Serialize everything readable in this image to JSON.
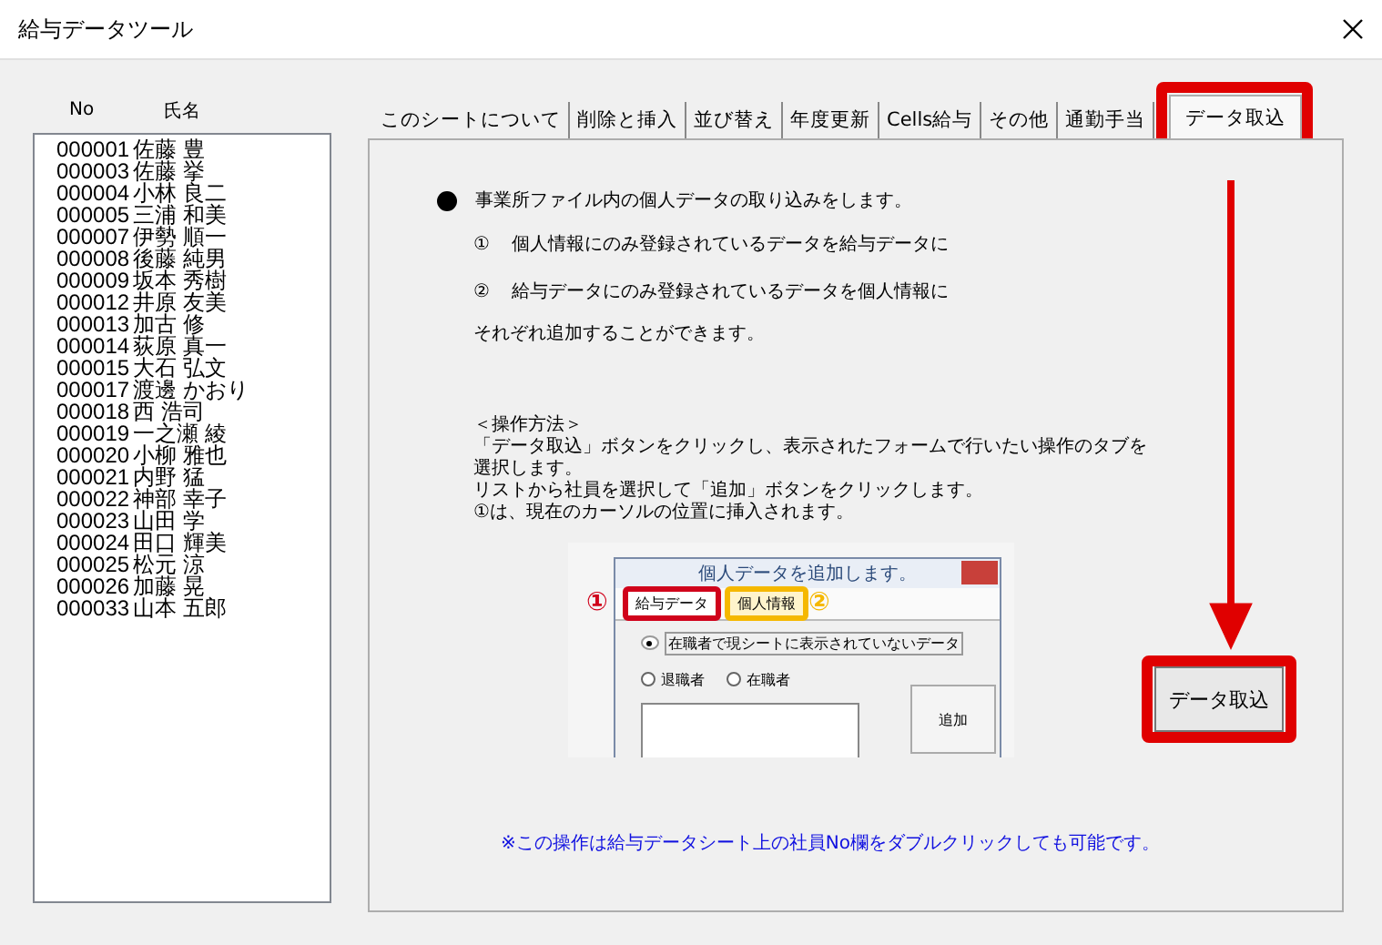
{
  "window": {
    "title": "給与データツール"
  },
  "employee_list": {
    "columns": [
      "No",
      "氏名"
    ],
    "rows": [
      {
        "no": "000001",
        "name": "佐藤 豊"
      },
      {
        "no": "000003",
        "name": "佐藤 挙"
      },
      {
        "no": "000004",
        "name": "小林 良二"
      },
      {
        "no": "000005",
        "name": "三浦 和美"
      },
      {
        "no": "000007",
        "name": "伊勢 順一"
      },
      {
        "no": "000008",
        "name": "後藤 純男"
      },
      {
        "no": "000009",
        "name": "坂本 秀樹"
      },
      {
        "no": "000012",
        "name": "井原 友美"
      },
      {
        "no": "000013",
        "name": "加古 修"
      },
      {
        "no": "000014",
        "name": "荻原 真一"
      },
      {
        "no": "000015",
        "name": "大石 弘文"
      },
      {
        "no": "000017",
        "name": "渡邊 かおり"
      },
      {
        "no": "000018",
        "name": "西 浩司"
      },
      {
        "no": "000019",
        "name": "一之瀬 綾"
      },
      {
        "no": "000020",
        "name": "小柳 雅也"
      },
      {
        "no": "000021",
        "name": "内野 猛"
      },
      {
        "no": "000022",
        "name": "神部 幸子"
      },
      {
        "no": "000023",
        "name": "山田 学"
      },
      {
        "no": "000024",
        "name": "田口 輝美"
      },
      {
        "no": "000025",
        "name": "松元 涼"
      },
      {
        "no": "000026",
        "name": "加藤 晃"
      },
      {
        "no": "000033",
        "name": "山本 五郎"
      }
    ]
  },
  "tabs": [
    {
      "label": "このシートについて",
      "selected": false,
      "highlighted": false
    },
    {
      "label": "削除と挿入",
      "selected": false,
      "highlighted": false
    },
    {
      "label": "並び替え",
      "selected": false,
      "highlighted": false
    },
    {
      "label": "年度更新",
      "selected": false,
      "highlighted": false
    },
    {
      "label": "Cells給与",
      "selected": false,
      "highlighted": false
    },
    {
      "label": "その他",
      "selected": false,
      "highlighted": false
    },
    {
      "label": "通勤手当",
      "selected": false,
      "highlighted": false
    },
    {
      "label": "データ取込",
      "selected": true,
      "highlighted": true
    }
  ],
  "content": {
    "intro": "事業所ファイル内の個人データの取り込みをします。",
    "items": [
      {
        "marker": "①",
        "text": "個人情報にのみ登録されているデータを給与データに"
      },
      {
        "marker": "②",
        "text": "給与データにのみ登録されているデータを個人情報に"
      }
    ],
    "summary": "それぞれ追加することができます。",
    "howto_title": "＜操作方法＞",
    "howto_lines": [
      "「データ取込」ボタンをクリックし、表示されたフォームで行いたい操作のタブを",
      "選択します。",
      "リストから社員を選択して「追加」ボタンをクリックします。",
      "①は、現在のカーソルの位置に挿入されます。"
    ],
    "note": "※この操作は給与データシート上の社員No欄をダブルクリックしても可能です。"
  },
  "example_image": {
    "title": "個人データを追加します。",
    "tabs": [
      {
        "label": "給与データ",
        "callout": "①",
        "color": "#d0021b",
        "selected": true
      },
      {
        "label": "個人情報",
        "callout": "②",
        "color": "#f5b800",
        "selected": false
      }
    ],
    "radio_options": [
      {
        "label": "在職者で現シートに表示されていないデータ",
        "checked": true
      },
      {
        "label": "退職者",
        "checked": false
      },
      {
        "label": "在職者",
        "checked": false
      }
    ],
    "button": "追加"
  },
  "import_button": {
    "label": "データ取込",
    "highlighted": true
  }
}
